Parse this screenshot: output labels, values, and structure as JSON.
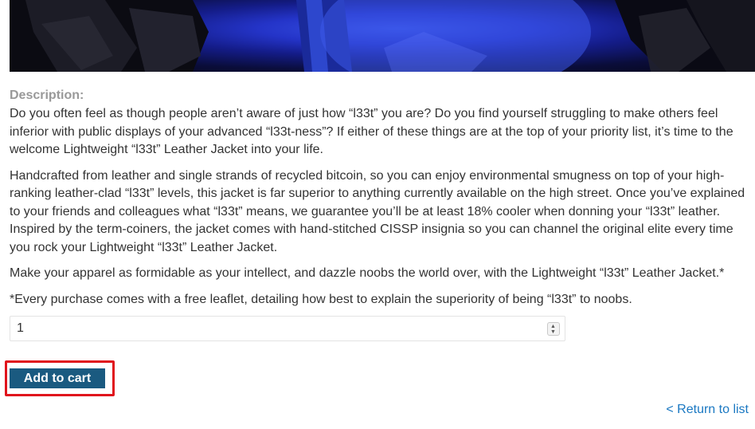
{
  "product": {
    "image_icon": "jacket-photo",
    "description_label": "Description:",
    "paragraphs": [
      "Do you often feel as though people aren’t aware of just how “l33t” you are? Do you find yourself struggling to make others feel inferior with public displays of your advanced “l33t-ness”? If either of these things are at the top of your priority list, it’s time to the welcome Lightweight “l33t” Leather Jacket into your life.",
      "Handcrafted from leather and single strands of recycled bitcoin, so you can enjoy environmental smugness on top of your high-ranking leather-clad “l33t” levels, this jacket is far superior to anything currently available on the high street. Once you’ve explained to your friends and colleagues what “l33t” means, we guarantee you’ll be at least 18% cooler when donning your “l33t” leather. Inspired by the term-coiners, the jacket comes with hand-stitched CISSP insignia so you can channel the original elite every time you rock your Lightweight “l33t” Leather Jacket.",
      "Make your apparel as formidable as your intellect, and dazzle noobs the world over, with the Lightweight “l33t” Leather Jacket.*",
      "*Every purchase comes with a free leaflet, detailing how best to explain the superiority of being “l33t” to noobs."
    ]
  },
  "cart": {
    "quantity_value": "1",
    "add_label": "Add to cart",
    "highlight_color": "#e0141c",
    "button_color": "#1a5a80"
  },
  "nav": {
    "return_label": "< Return to list",
    "link_color": "#1a78c2"
  }
}
